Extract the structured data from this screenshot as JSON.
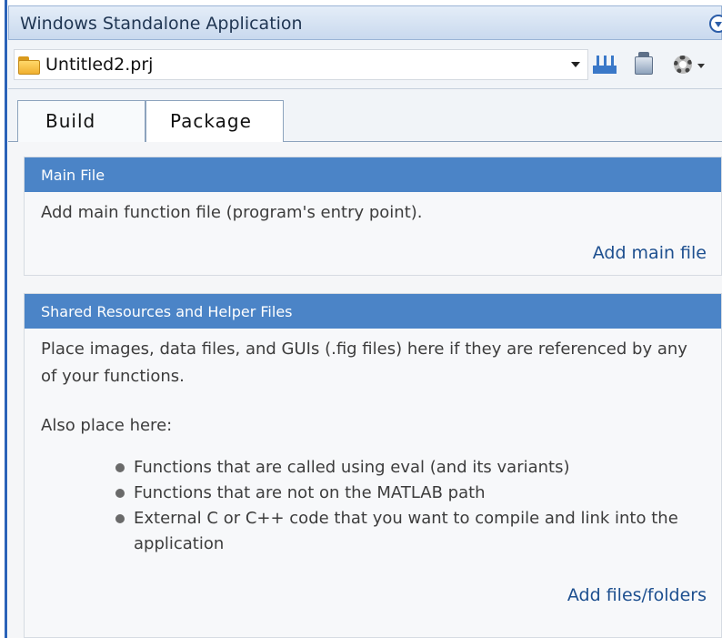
{
  "window": {
    "title": "Windows Standalone Application"
  },
  "toolbar": {
    "project_name": "Untitled2.prj",
    "icons": [
      "folder-icon",
      "build-icon",
      "package-icon",
      "settings-icon"
    ]
  },
  "tabs": [
    {
      "label": "Build",
      "active": true
    },
    {
      "label": "Package",
      "active": false
    }
  ],
  "main_file": {
    "header": "Main File",
    "description": "Add main function file (program's entry point).",
    "action": "Add main file"
  },
  "shared": {
    "header": "Shared Resources and Helper Files",
    "description": "Place images, data files, and GUIs (.fig files) here if they are referenced by any of your functions.",
    "also": "Also place here:",
    "bullets": [
      "Functions that are called using eval (and its variants)",
      "Functions that are not on the MATLAB path",
      "External C or C++ code that you want to compile and link into the application"
    ],
    "action": "Add files/folders"
  },
  "colors": {
    "panel_header": "#4b84c7",
    "link": "#1d4f8f",
    "accent_blue": "#2b63b8"
  }
}
